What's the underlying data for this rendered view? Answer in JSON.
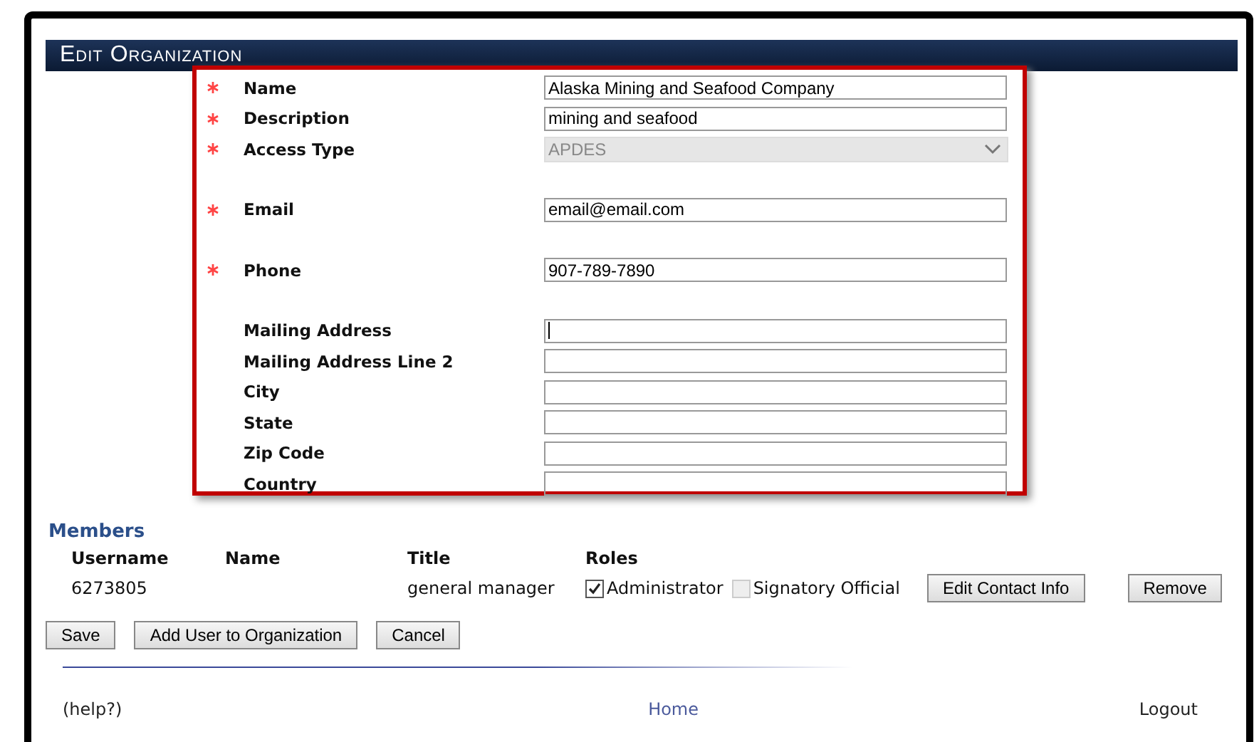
{
  "window": {
    "title": "Edit Organization"
  },
  "form_groups": [
    {
      "fields": [
        {
          "label": "Name",
          "required": true,
          "kind": "text",
          "value": "Alaska Mining and Seafood Company"
        },
        {
          "label": "Description",
          "required": true,
          "kind": "text",
          "value": "mining and seafood"
        },
        {
          "label": "Access Type",
          "required": true,
          "kind": "select",
          "value": "APDES",
          "disabled": true
        }
      ]
    },
    {
      "fields": [
        {
          "label": "Email",
          "required": true,
          "kind": "text",
          "value": "email@email.com"
        }
      ]
    },
    {
      "fields": [
        {
          "label": "Phone",
          "required": true,
          "kind": "text",
          "value": "907-789-7890"
        }
      ]
    },
    {
      "fields": [
        {
          "label": "Mailing Address",
          "required": false,
          "kind": "text",
          "focused": true
        },
        {
          "label": "Mailing Address Line 2",
          "required": false,
          "kind": "text"
        },
        {
          "label": "City",
          "required": false,
          "kind": "text"
        },
        {
          "label": "State",
          "required": false,
          "kind": "text"
        },
        {
          "label": "Zip Code",
          "required": false,
          "kind": "text"
        },
        {
          "label": "Country",
          "required": false,
          "kind": "text"
        }
      ]
    }
  ],
  "members": {
    "title": "Members",
    "columns": [
      "Username",
      "Name",
      "Title",
      "Roles"
    ],
    "rows": [
      {
        "username": "6273805",
        "title": "general manager",
        "roles": [
          {
            "label": "Administrator",
            "checked": true,
            "disabled": false
          },
          {
            "label": "Signatory Official",
            "checked": false,
            "disabled": true
          }
        ],
        "actions": [
          "Edit Contact Info",
          "Remove"
        ]
      }
    ]
  },
  "buttons": [
    "Save",
    "Add User to Organization",
    "Cancel"
  ],
  "footer": {
    "help": "(help?)",
    "home": "Home",
    "logout": "Logout"
  }
}
